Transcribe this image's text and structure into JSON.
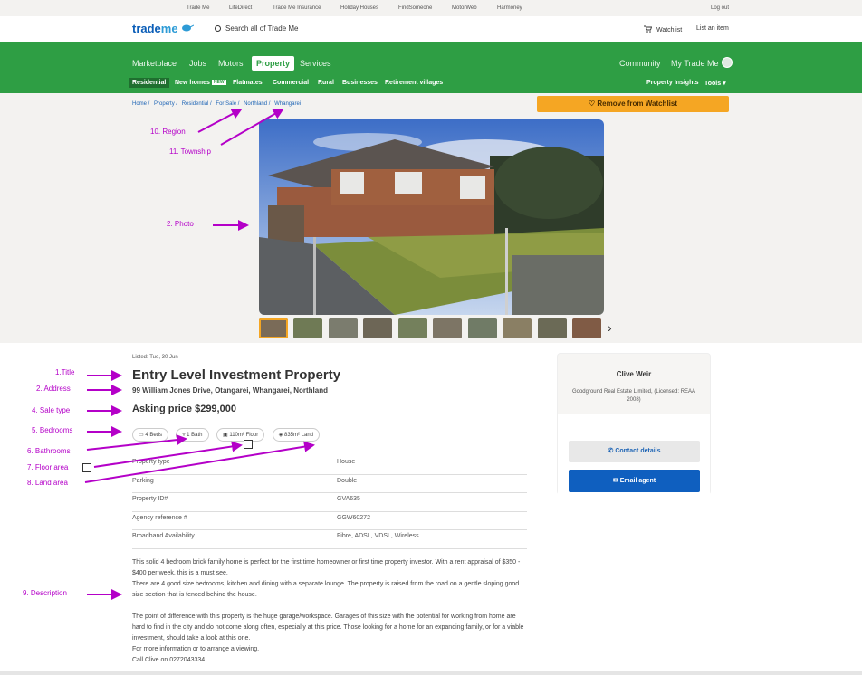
{
  "util_bar": [
    "Trade Me",
    "LifeDirect",
    "Trade Me Insurance",
    "Holiday Houses",
    "FindSomeone",
    "MotorWeb",
    "Harmoney",
    "Log out"
  ],
  "header": {
    "logo_a": "trade",
    "logo_b": "me",
    "search_placeholder": "Search all of Trade Me",
    "watchlist": "Watchlist",
    "list_item": "List an item"
  },
  "nav": {
    "main": [
      "Marketplace",
      "Jobs",
      "Motors",
      "Property",
      "Services"
    ],
    "right": [
      "Community",
      "My Trade Me"
    ],
    "sub": [
      "Residential",
      "New homes",
      "Flatmates",
      "Commercial",
      "Rural",
      "Businesses",
      "Retirement villages"
    ],
    "new_badge": "NEW",
    "sub_right": [
      "Property Insights",
      "Tools"
    ]
  },
  "breadcrumb": [
    "Home /",
    "Property /",
    "Residential /",
    "For Sale /",
    "Northland /",
    "Whangarei"
  ],
  "watch_button": "Remove from Watchlist",
  "listing": {
    "listed": "Listed: Tue, 30 Jun",
    "title": "Entry Level Investment Property",
    "address": "99 William Jones Drive, Otangarei, Whangarei, Northland",
    "price": "Asking price $299,000",
    "chips": [
      "4 Beds",
      "1 Bath",
      "110m² Floor",
      "835m² Land"
    ],
    "attributes": [
      {
        "k": "Property type",
        "v": "House"
      },
      {
        "k": "Parking",
        "v": "Double"
      },
      {
        "k": "Property ID#",
        "v": "GVA635"
      },
      {
        "k": "Agency reference #",
        "v": "GGW60272"
      },
      {
        "k": "Broadband Availability",
        "v": "Fibre, ADSL, VDSL, Wireless"
      }
    ],
    "description": [
      "This solid 4 bedroom brick family home is perfect for the first time homeowner or first time property investor. With a rent appraisal of $350 - $400 per week, this is a must see.",
      "There are 4 good size bedrooms, kitchen and dining with a separate lounge. The property is raised from the road on a gentle sloping good size section that is fenced behind the house.",
      "The point of difference with this property is the huge garage/workspace. Garages of this size with the potential for working from home are hard to find in the city and do not come along often, especially at this price. Those looking for a home for an expanding family, or for a viable investment, should take a look at this one.",
      "For more information or to arrange a viewing,",
      "Call Clive on 0272043334"
    ]
  },
  "agent": {
    "name": "Clive Weir",
    "company": "Goodground Real Estate Limited, (Licensed: REAA 2008)",
    "contact": "Contact details",
    "email": "Email agent"
  },
  "annotations": {
    "region": "10. Region",
    "township": "11. Township",
    "photo": "2. Photo",
    "title": "1.Title",
    "address": "2. Address",
    "sale_type": "4. Sale type",
    "bedrooms": "5. Bedrooms",
    "bathrooms": "6. Bathrooms",
    "floor": "7. Floor area",
    "land": "8. Land area",
    "description": "9. Description"
  },
  "colors": {
    "green": "#2e9e44",
    "orange": "#f5a623",
    "blue": "#0f5fbf",
    "annotation": "#b400c8"
  }
}
